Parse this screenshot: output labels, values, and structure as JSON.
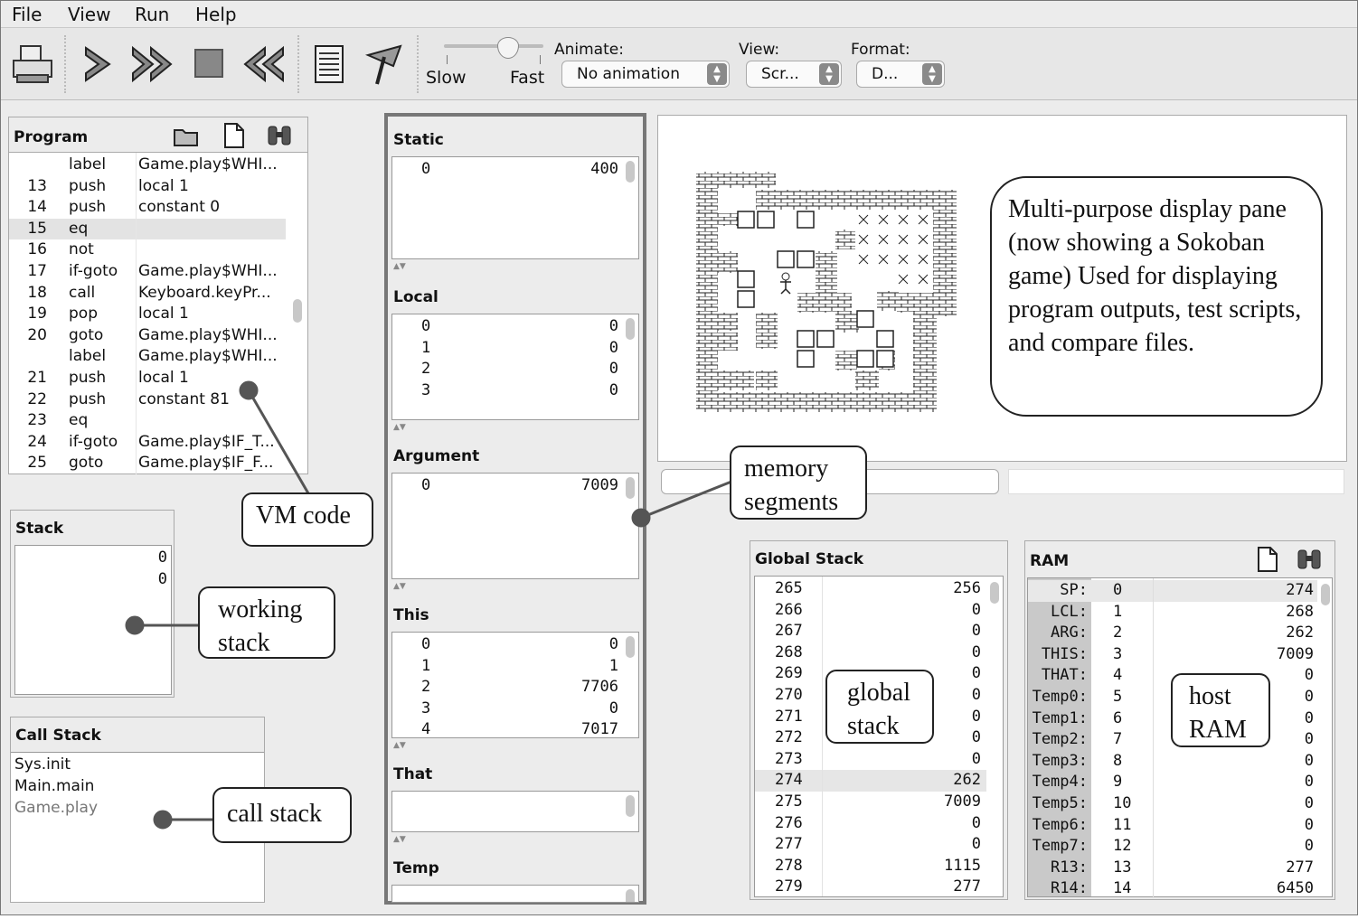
{
  "menu": [
    "File",
    "View",
    "Run",
    "Help"
  ],
  "toolbar": {
    "slow_label": "Slow",
    "fast_label": "Fast",
    "animate_label": "Animate:",
    "animate_value": "No animation",
    "view_label": "View:",
    "view_value": "Scr...",
    "format_label": "Format:",
    "format_value": "D..."
  },
  "program": {
    "title": "Program",
    "rows": [
      {
        "num": "",
        "cmd": "label",
        "arg": "Game.play$WHI..."
      },
      {
        "num": "13",
        "cmd": "push",
        "arg": "local 1"
      },
      {
        "num": "14",
        "cmd": "push",
        "arg": "constant 0"
      },
      {
        "num": "15",
        "cmd": "eq",
        "arg": ""
      },
      {
        "num": "16",
        "cmd": "not",
        "arg": ""
      },
      {
        "num": "17",
        "cmd": "if-goto",
        "arg": "Game.play$WHI..."
      },
      {
        "num": "18",
        "cmd": "call",
        "arg": "Keyboard.keyPr..."
      },
      {
        "num": "19",
        "cmd": "pop",
        "arg": "local 1"
      },
      {
        "num": "20",
        "cmd": "goto",
        "arg": "Game.play$WHI..."
      },
      {
        "num": "",
        "cmd": "label",
        "arg": "Game.play$WHI..."
      },
      {
        "num": "21",
        "cmd": "push",
        "arg": "local 1"
      },
      {
        "num": "22",
        "cmd": "push",
        "arg": "constant 81"
      },
      {
        "num": "23",
        "cmd": "eq",
        "arg": ""
      },
      {
        "num": "24",
        "cmd": "if-goto",
        "arg": "Game.play$IF_T..."
      },
      {
        "num": "25",
        "cmd": "goto",
        "arg": "Game.play$IF_F..."
      }
    ]
  },
  "stack": {
    "title": "Stack",
    "values": [
      "0",
      "0"
    ]
  },
  "call_stack": {
    "title": "Call Stack",
    "items": [
      "Sys.init",
      "Main.main",
      "Game.play"
    ]
  },
  "segments": {
    "static": {
      "title": "Static",
      "rows": [
        [
          "0",
          "400"
        ]
      ]
    },
    "local": {
      "title": "Local",
      "rows": [
        [
          "0",
          "0"
        ],
        [
          "1",
          "0"
        ],
        [
          "2",
          "0"
        ],
        [
          "3",
          "0"
        ]
      ]
    },
    "argument": {
      "title": "Argument",
      "rows": [
        [
          "0",
          "7009"
        ]
      ]
    },
    "this": {
      "title": "This",
      "rows": [
        [
          "0",
          "0"
        ],
        [
          "1",
          "1"
        ],
        [
          "2",
          "7706"
        ],
        [
          "3",
          "0"
        ],
        [
          "4",
          "7017"
        ]
      ]
    },
    "that": {
      "title": "That",
      "rows": []
    },
    "temp": {
      "title": "Temp",
      "rows": []
    }
  },
  "global_stack": {
    "title": "Global Stack",
    "rows": [
      [
        "265",
        "256"
      ],
      [
        "266",
        "0"
      ],
      [
        "267",
        "0"
      ],
      [
        "268",
        "0"
      ],
      [
        "269",
        "0"
      ],
      [
        "270",
        "0"
      ],
      [
        "271",
        "0"
      ],
      [
        "272",
        "0"
      ],
      [
        "273",
        "0"
      ],
      [
        "274",
        "262"
      ],
      [
        "275",
        "7009"
      ],
      [
        "276",
        "0"
      ],
      [
        "277",
        "0"
      ],
      [
        "278",
        "1115"
      ],
      [
        "279",
        "277"
      ]
    ]
  },
  "ram": {
    "title": "RAM",
    "rows": [
      [
        "SP:",
        "0",
        "274"
      ],
      [
        "LCL:",
        "1",
        "268"
      ],
      [
        "ARG:",
        "2",
        "262"
      ],
      [
        "THIS:",
        "3",
        "7009"
      ],
      [
        "THAT:",
        "4",
        "0"
      ],
      [
        "Temp0:",
        "5",
        "0"
      ],
      [
        "Temp1:",
        "6",
        "0"
      ],
      [
        "Temp2:",
        "7",
        "0"
      ],
      [
        "Temp3:",
        "8",
        "0"
      ],
      [
        "Temp4:",
        "9",
        "0"
      ],
      [
        "Temp5:",
        "10",
        "0"
      ],
      [
        "Temp6:",
        "11",
        "0"
      ],
      [
        "Temp7:",
        "12",
        "0"
      ],
      [
        "R13:",
        "13",
        "277"
      ],
      [
        "R14:",
        "14",
        "6450"
      ]
    ]
  },
  "callouts": {
    "display": "Multi-purpose display pane (now showing a Sokoban game) Used for displaying program outputs, test scripts, and compare files.",
    "vm_code": "VM code",
    "memory_segments": "memory segments",
    "working_stack": "working stack",
    "call_stack": "call stack",
    "global_stack": "global stack",
    "host_ram": "host RAM"
  },
  "icons": [
    "print-icon",
    "step-icon",
    "run-icon",
    "stop-icon",
    "reset-icon",
    "script-icon",
    "breakpoint-icon",
    "open-folder-icon",
    "new-file-icon",
    "find-icon"
  ]
}
